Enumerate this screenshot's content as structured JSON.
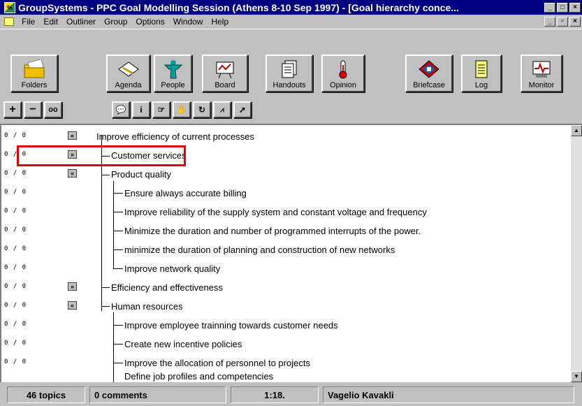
{
  "window": {
    "title": "GroupSystems - PPC Goal Modelling Session (Athens 8-10 Sep 1997) - [Goal hierarchy conce...",
    "app_icon_label": "%"
  },
  "menu": [
    "File",
    "Edit",
    "Outliner",
    "Group",
    "Options",
    "Window",
    "Help"
  ],
  "toolbar": {
    "buttons": [
      "Folders",
      "Agenda",
      "People",
      "Board",
      "Handouts",
      "Opinion",
      "Briefcase",
      "Log",
      "Monitor"
    ]
  },
  "outline": {
    "rows": [
      {
        "score": "0 / 0",
        "expander": "«",
        "text": "Improve efficiency of current processes"
      },
      {
        "score": "0 / 0",
        "expander": "»",
        "text": "Customer services"
      },
      {
        "score": "0 / 0",
        "expander": "«",
        "text": "Product quality"
      },
      {
        "score": "0 / 0",
        "expander": "",
        "text": "Ensure always accurate billing"
      },
      {
        "score": "0 / 0",
        "expander": "",
        "text": "Improve reliability of the supply system and constant voltage and frequency"
      },
      {
        "score": "0 / 0",
        "expander": "",
        "text": "Minimize the duration and number of programmed interrupts of the power."
      },
      {
        "score": "0 / 0",
        "expander": "",
        "text": "minimize the duration of planning and construction of new networks"
      },
      {
        "score": "0 / 0",
        "expander": "",
        "text": "Improve network quality"
      },
      {
        "score": "0 / 0",
        "expander": "»",
        "text": "Efficiency and effectiveness"
      },
      {
        "score": "0 / 0",
        "expander": "«",
        "text": "Human resources"
      },
      {
        "score": "0 / 0",
        "expander": "",
        "text": "Improve employee trainning towards customer needs"
      },
      {
        "score": "0 / 0",
        "expander": "",
        "text": "Create new incentive policies"
      },
      {
        "score": "0 / 0",
        "expander": "",
        "text": "Improve the allocation of personnel to projects"
      },
      {
        "score": "",
        "expander": "",
        "text": "Define job profiles and competencies"
      }
    ]
  },
  "status": {
    "topics": "46 topics",
    "comments": "0 comments",
    "time": "1:18.",
    "user": "Vagelio Kavakli"
  },
  "colors": {
    "titlebar": "#000080",
    "highlight": "#e00000",
    "face": "#c0c0c0"
  }
}
